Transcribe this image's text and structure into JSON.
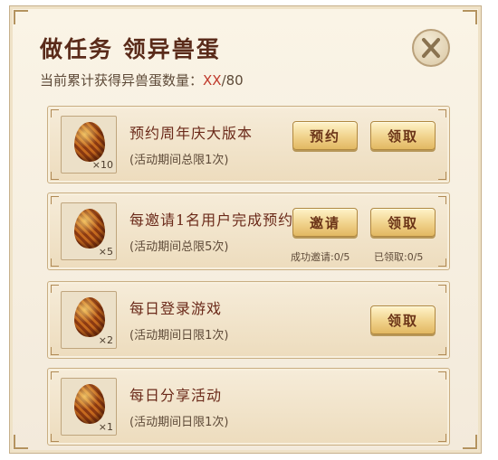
{
  "header": {
    "title": "做任务 领异兽蛋",
    "counter_label": "当前累计获得异兽蛋数量：",
    "counter_current": "XX",
    "counter_total": "/80"
  },
  "tasks": [
    {
      "title": "预约周年庆大版本",
      "limit": "(活动期间总限1次)",
      "qty": "×10",
      "btn1": "预约",
      "btn2": "领取"
    },
    {
      "title": "每邀请1名用户完成预约",
      "limit": "(活动期间总限5次)",
      "qty": "×5",
      "btn1": "邀请",
      "btn2": "领取",
      "sub1": "成功邀请:0/5",
      "sub2": "已领取:0/5"
    },
    {
      "title": "每日登录游戏",
      "limit": "(活动期间日限1次)",
      "qty": "×2",
      "btn2": "领取"
    },
    {
      "title": "每日分享活动",
      "limit": "(活动期间日限1次)",
      "qty": "×1"
    }
  ],
  "icons": {
    "close": "close-icon",
    "reward": "dragon-egg-icon"
  },
  "colors": {
    "title": "#5a2b1a",
    "counter_current": "#c0392b",
    "button": "#f0d28b"
  }
}
